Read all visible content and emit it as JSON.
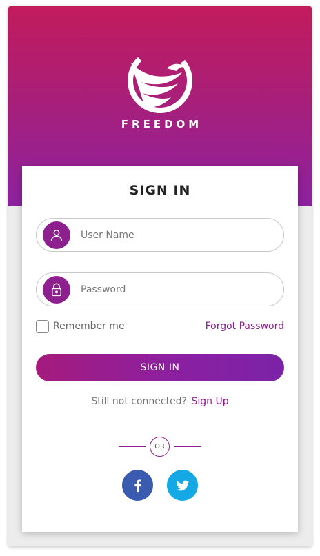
{
  "brand": {
    "name": "FREEDOM"
  },
  "form": {
    "title": "SIGN IN",
    "username_placeholder": "User Name",
    "password_placeholder": "Password",
    "remember_label": "Remember me",
    "forgot_label": "Forgot Password",
    "submit_label": "SIGN IN",
    "not_connected_text": "Still not connected?",
    "signup_label": "Sign Up",
    "or_label": "OR"
  },
  "icons": {
    "user": "user-icon",
    "lock": "lock-icon",
    "facebook": "facebook-icon",
    "twitter": "twitter-icon"
  },
  "colors": {
    "accent": "#8d1f8f",
    "header_top": "#c21b5c",
    "header_bottom": "#8c22a0",
    "facebook": "#3b5bb0",
    "twitter": "#14a9e4"
  }
}
